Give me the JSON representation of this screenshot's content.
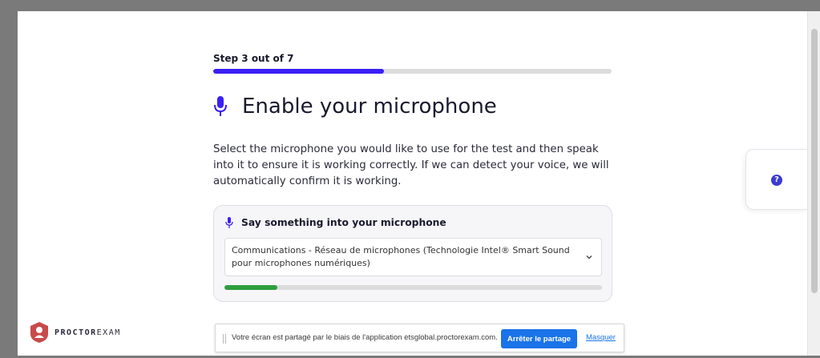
{
  "step": {
    "label": "Step 3 out of 7",
    "current": 3,
    "total": 7
  },
  "heading": {
    "title": "Enable your microphone",
    "icon": "microphone-icon"
  },
  "description": "Select the microphone you would like to use for the test and then speak into it to ensure it is working correctly. If we can detect your voice, we will automatically confirm it is working.",
  "card": {
    "title": "Say something into your microphone",
    "select_value": "Communications - Réseau de microphones (Technologie Intel® Smart Sound pour microphones numériques)",
    "level_fraction": 0.14
  },
  "help": {
    "icon": "help-icon",
    "glyph": "?"
  },
  "brand": {
    "bold": "PROCTOR",
    "light": "EXAM"
  },
  "share_bar": {
    "text": "Votre écran est partagé par le biais de l'application etsglobal.proctorexam.com.",
    "stop_label": "Arrêter le partage",
    "hide_label": "Masquer"
  },
  "colors": {
    "accent": "#3b1ff5",
    "level": "#2e9e3e",
    "brand_red": "#c94a4a"
  }
}
